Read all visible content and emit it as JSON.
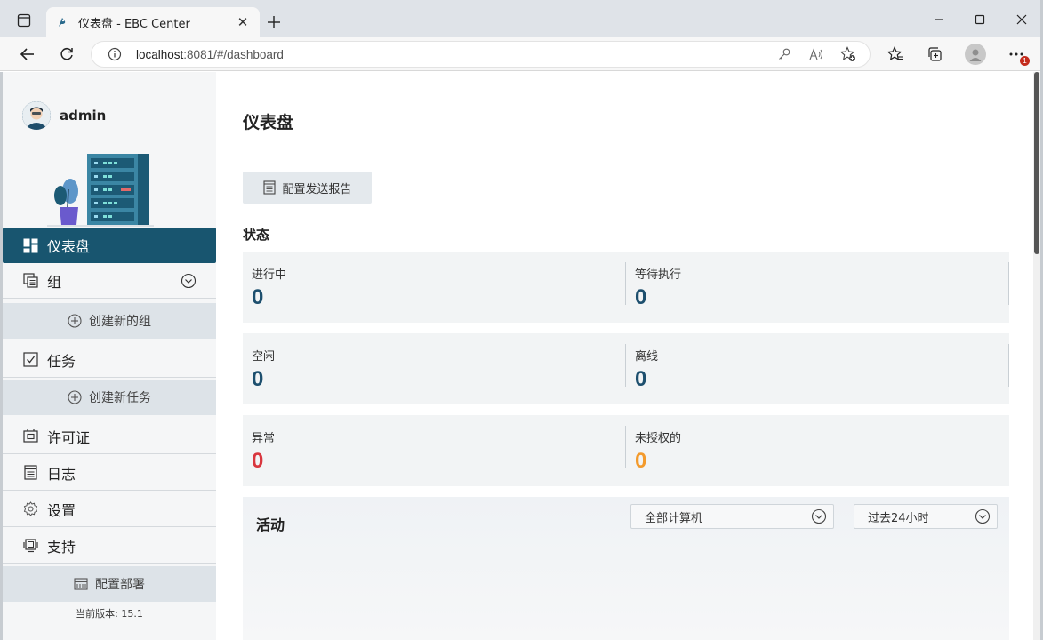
{
  "browser": {
    "tab_title": "仪表盘 - EBC Center",
    "url_host": "localhost",
    "url_rest": ":8081/#/dashboard",
    "notification_count": "1"
  },
  "sidebar": {
    "username": "admin",
    "items": [
      {
        "label": "仪表盘",
        "icon": "dashboard-icon"
      },
      {
        "label": "组",
        "icon": "group-icon"
      },
      {
        "label": "创建新的组",
        "icon": "plus-circle-icon"
      },
      {
        "label": "任务",
        "icon": "task-icon"
      },
      {
        "label": "创建新任务",
        "icon": "plus-circle-icon"
      },
      {
        "label": "许可证",
        "icon": "license-icon"
      },
      {
        "label": "日志",
        "icon": "log-icon"
      },
      {
        "label": "设置",
        "icon": "gear-icon"
      },
      {
        "label": "支持",
        "icon": "support-icon"
      },
      {
        "label": "配置部署",
        "icon": "deploy-icon"
      }
    ],
    "version": "当前版本: 15.1"
  },
  "main": {
    "title": "仪表盘",
    "report_button": "配置发送报告",
    "status_title": "状态",
    "stats": [
      {
        "label": "进行中",
        "value": "0"
      },
      {
        "label": "等待执行",
        "value": "0"
      },
      {
        "label": "空闲",
        "value": "0"
      },
      {
        "label": "离线",
        "value": "0"
      },
      {
        "label": "异常",
        "value": "0"
      },
      {
        "label": "未授权的",
        "value": "0"
      }
    ],
    "activity": {
      "title": "活动",
      "computer_filter": "全部计算机",
      "time_filter": "过去24小时"
    }
  },
  "colors": {
    "accent": "#18556f",
    "stat_value": "#1d4f6e",
    "error": "#d9363e",
    "warning": "#f39a2c"
  }
}
